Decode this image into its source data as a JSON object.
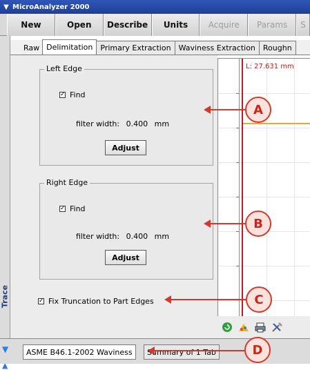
{
  "window": {
    "title": "MicroAnalyzer 2000"
  },
  "toolbar": {
    "buttons": [
      {
        "label": "New",
        "enabled": true
      },
      {
        "label": "Open",
        "enabled": true
      },
      {
        "label": "Describe",
        "enabled": true
      },
      {
        "label": "Units",
        "enabled": true
      },
      {
        "label": "Acquire",
        "enabled": false
      },
      {
        "label": "Params",
        "enabled": false
      },
      {
        "label": "S",
        "enabled": false
      }
    ]
  },
  "sidepanel": {
    "label": "Trace Processing"
  },
  "tabs": [
    {
      "label": "Raw"
    },
    {
      "label": "Delimitation"
    },
    {
      "label": "Primary Extraction"
    },
    {
      "label": "Waviness Extraction"
    },
    {
      "label": "Roughn"
    }
  ],
  "left_edge": {
    "title": "Left Edge",
    "find_label": "Find",
    "find_checked": true,
    "filter_label": "filter width:",
    "filter_value": "0.400",
    "filter_unit": "mm",
    "adjust_label": "Adjust"
  },
  "right_edge": {
    "title": "Right Edge",
    "find_label": "Find",
    "find_checked": true,
    "filter_label": "filter width:",
    "filter_value": "0.400",
    "filter_unit": "mm",
    "adjust_label": "Adjust"
  },
  "fix_truncation": {
    "label": "Fix Truncation to Part Edges",
    "checked": true
  },
  "plot": {
    "cursor_label": "L:  27.631 mm",
    "trace_color": "#f5a623",
    "cursor_color": "#b51f1f"
  },
  "bottom_tabs": [
    {
      "label": "ASME B46.1-2002 Waviness"
    },
    {
      "label": "Summary of 1 Tab"
    }
  ],
  "callouts": [
    "A",
    "B",
    "C",
    "D"
  ],
  "colors": {
    "accent": "#d3392c",
    "titlebar": "#1d3f96"
  }
}
